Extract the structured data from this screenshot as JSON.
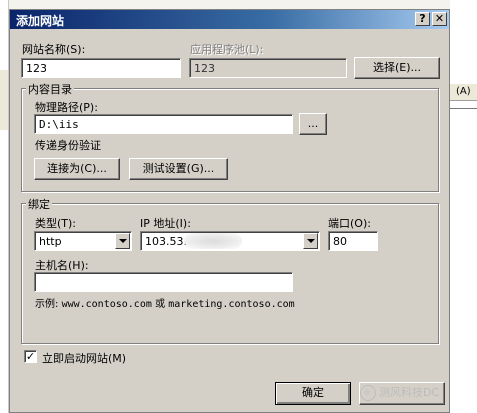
{
  "dialog": {
    "title": "添加网站",
    "help_button": "?",
    "close_button": "✕"
  },
  "site": {
    "site_name_label": "网站名称(S):",
    "site_name_value": "123",
    "app_pool_label": "应用程序池(L):",
    "app_pool_value": "123",
    "select_button": "选择(E)..."
  },
  "content": {
    "group_label": "内容目录",
    "physical_path_label": "物理路径(P):",
    "physical_path_value": "D:\\iis",
    "browse_button": "...",
    "pass_through_label": "传递身份验证",
    "connect_as_button": "连接为(C)...",
    "test_settings_button": "测试设置(G)..."
  },
  "binding": {
    "group_label": "绑定",
    "type_label": "类型(T):",
    "type_value": "http",
    "ip_label": "IP 地址(I):",
    "ip_value": "103.53.",
    "port_label": "端口(O):",
    "port_value": "80",
    "host_label": "主机名(H):",
    "host_value": "",
    "example_prefix": "示例:",
    "example_domain1": "www.contoso.com",
    "example_or": "或",
    "example_domain2": "marketing.contoso.com"
  },
  "start": {
    "checkbox_mark": "✓",
    "label": "立即启动网站(M)"
  },
  "footer": {
    "ok_button": "确定",
    "cancel_fragment": "",
    "watermark": "测风科技DC"
  },
  "background": {
    "right_fragment": "(A)"
  }
}
